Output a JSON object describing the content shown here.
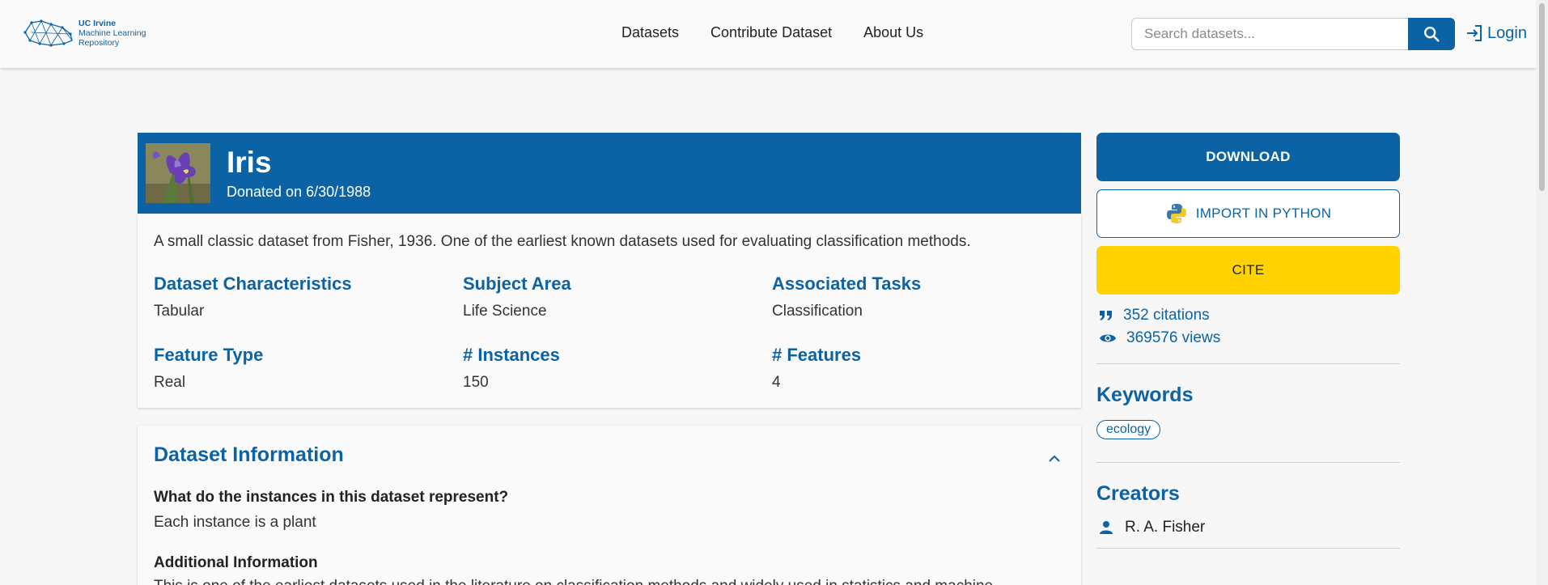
{
  "header": {
    "logo_lines": [
      "UC Irvine",
      "Machine Learning",
      "Repository"
    ],
    "nav": [
      "Datasets",
      "Contribute Dataset",
      "About Us"
    ],
    "search_placeholder": "Search datasets...",
    "login_label": "Login"
  },
  "dataset": {
    "title": "Iris",
    "donated": "Donated on 6/30/1988",
    "description": "A small classic dataset from Fisher, 1936. One of the earliest known datasets used for evaluating classification methods.",
    "characteristics": [
      {
        "label": "Dataset Characteristics",
        "value": "Tabular"
      },
      {
        "label": "Subject Area",
        "value": "Life Science"
      },
      {
        "label": "Associated Tasks",
        "value": "Classification"
      },
      {
        "label": "Feature Type",
        "value": "Real"
      },
      {
        "label": "# Instances",
        "value": "150"
      },
      {
        "label": "# Features",
        "value": "4"
      }
    ]
  },
  "info_section": {
    "title": "Dataset Information",
    "q1": "What do the instances in this dataset represent?",
    "a1": "Each instance is a plant",
    "q2": "Additional Information",
    "a2": "This is one of the earliest datasets used in the literature on classification methods and widely used in statistics and machine"
  },
  "sidebar": {
    "download_label": "DOWNLOAD",
    "import_label": "IMPORT IN PYTHON",
    "cite_label": "CITE",
    "citations": "352 citations",
    "views": "369576 views",
    "keywords_heading": "Keywords",
    "keywords": [
      "ecology"
    ],
    "creators_heading": "Creators",
    "creators": [
      "R. A. Fisher"
    ]
  },
  "colors": {
    "brand_blue": "#0b63a5",
    "cite_yellow": "#ffd200"
  },
  "icons": [
    "uci-logo",
    "search-icon",
    "login-icon",
    "python-icon",
    "quote-icon",
    "eye-icon",
    "chevron-up-icon",
    "person-icon"
  ]
}
